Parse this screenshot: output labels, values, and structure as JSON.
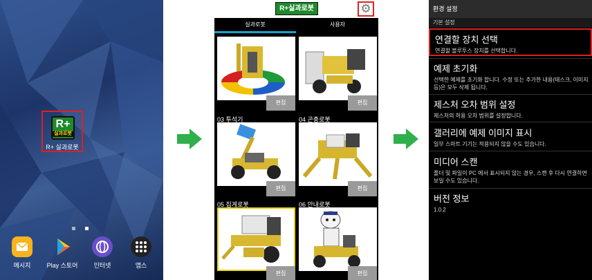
{
  "home": {
    "app_label": "R+ 실과로봇",
    "app_logo_text": "R+",
    "app_logo_sub": "실과로봇",
    "dock": [
      {
        "label": "메시지",
        "icon": "message-icon",
        "color": "#f7b41c"
      },
      {
        "label": "Play 스토어",
        "icon": "play-store-icon",
        "color": "#2fb65a"
      },
      {
        "label": "인터넷",
        "icon": "internet-icon",
        "color": "#6a4fc8"
      },
      {
        "label": "앱스",
        "icon": "apps-grid-icon",
        "color": "#222222"
      }
    ]
  },
  "gallery": {
    "header_logo": "R+실과로봇",
    "tabs": [
      "실과로봇",
      "사용자"
    ],
    "edit_label": "편집",
    "cards": [
      {
        "title": "",
        "art": "robot-turntable"
      },
      {
        "title": "",
        "art": "robot-forklift"
      },
      {
        "title": "03 투석기",
        "art": "robot-catapult"
      },
      {
        "title": "04 곤충로봇",
        "art": "robot-insect"
      },
      {
        "title": "05 집게로봇",
        "art": "robot-gripper"
      },
      {
        "title": "06 안내로봇",
        "art": "robot-guide"
      }
    ]
  },
  "settings": {
    "header": "환경 설정",
    "section": "기본 설정",
    "items": [
      {
        "title": "연결할 장치 선택",
        "desc": "연결할 블루투스 장치를 선택합니다."
      },
      {
        "title": "예제 초기화",
        "desc": "선택한 예제를 초기화 합니다. 수정 또는 추가한 내용(태스크, 이미지 등)은 모두 삭제 됩니다."
      },
      {
        "title": "제스처 오차 범위 설정",
        "desc": "제스처의 허용 오차 범위를 설정합니다."
      },
      {
        "title": "갤러리에 예제 이미지 표시",
        "desc": "일부 스마트 기기는 적용되지 않을 수도 있습니다."
      },
      {
        "title": "미디어 스캔",
        "desc": "폴더 및 파일이 PC 에서 표시되지 않는 경우, 스캔 후 다시 연결하면 보일 수도 있습니다."
      },
      {
        "title": "버전 정보",
        "desc": "1.0.2"
      }
    ]
  },
  "colors": {
    "highlight": "#e02020",
    "arrow": "#2fb04a",
    "tab_accent": "#14a3d8",
    "selected_card": "#e8d300"
  }
}
